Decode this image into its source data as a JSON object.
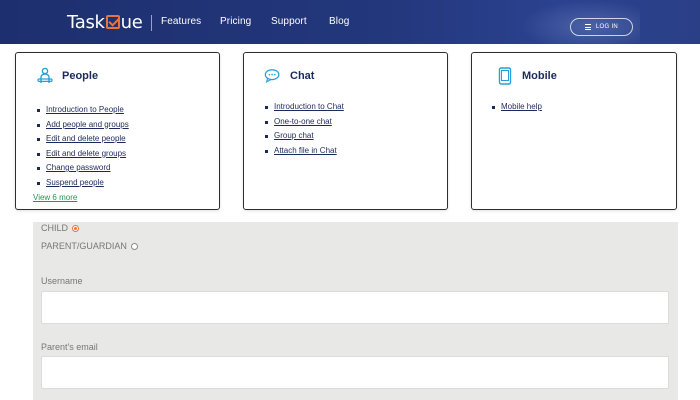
{
  "nav": {
    "logo_prefix": "Task",
    "logo_suffix": "ue",
    "links": [
      "Features",
      "Pricing",
      "Support",
      "Blog"
    ],
    "login_label": "LOG IN"
  },
  "cards": [
    {
      "title": "People",
      "icon": "person-presenting-icon",
      "items": [
        "Introduction to People",
        "Add people and groups",
        "Edit and delete people",
        "Edit and delete groups",
        "Change password",
        "Suspend people"
      ],
      "view_more": "View 6 more"
    },
    {
      "title": "Chat",
      "icon": "chat-bubble-icon",
      "items": [
        "Introduction to Chat",
        "One-to-one chat",
        "Group chat",
        "Attach file in Chat"
      ]
    },
    {
      "title": "Mobile",
      "icon": "mobile-phone-icon",
      "items": [
        "Mobile help"
      ]
    }
  ],
  "form": {
    "role_options": [
      {
        "label": "CHILD",
        "checked": true
      },
      {
        "label": "PARENT/GUARDIAN",
        "checked": false
      }
    ],
    "username_label": "Username",
    "username_value": "",
    "parent_email_label": "Parent's email",
    "parent_email_value": ""
  },
  "colors": {
    "nav_bg": "#23377c",
    "accent": "#e8743b",
    "link_green": "#1e9a4a",
    "text_navy": "#1b2a5c",
    "form_bg": "#e8e8e6"
  }
}
